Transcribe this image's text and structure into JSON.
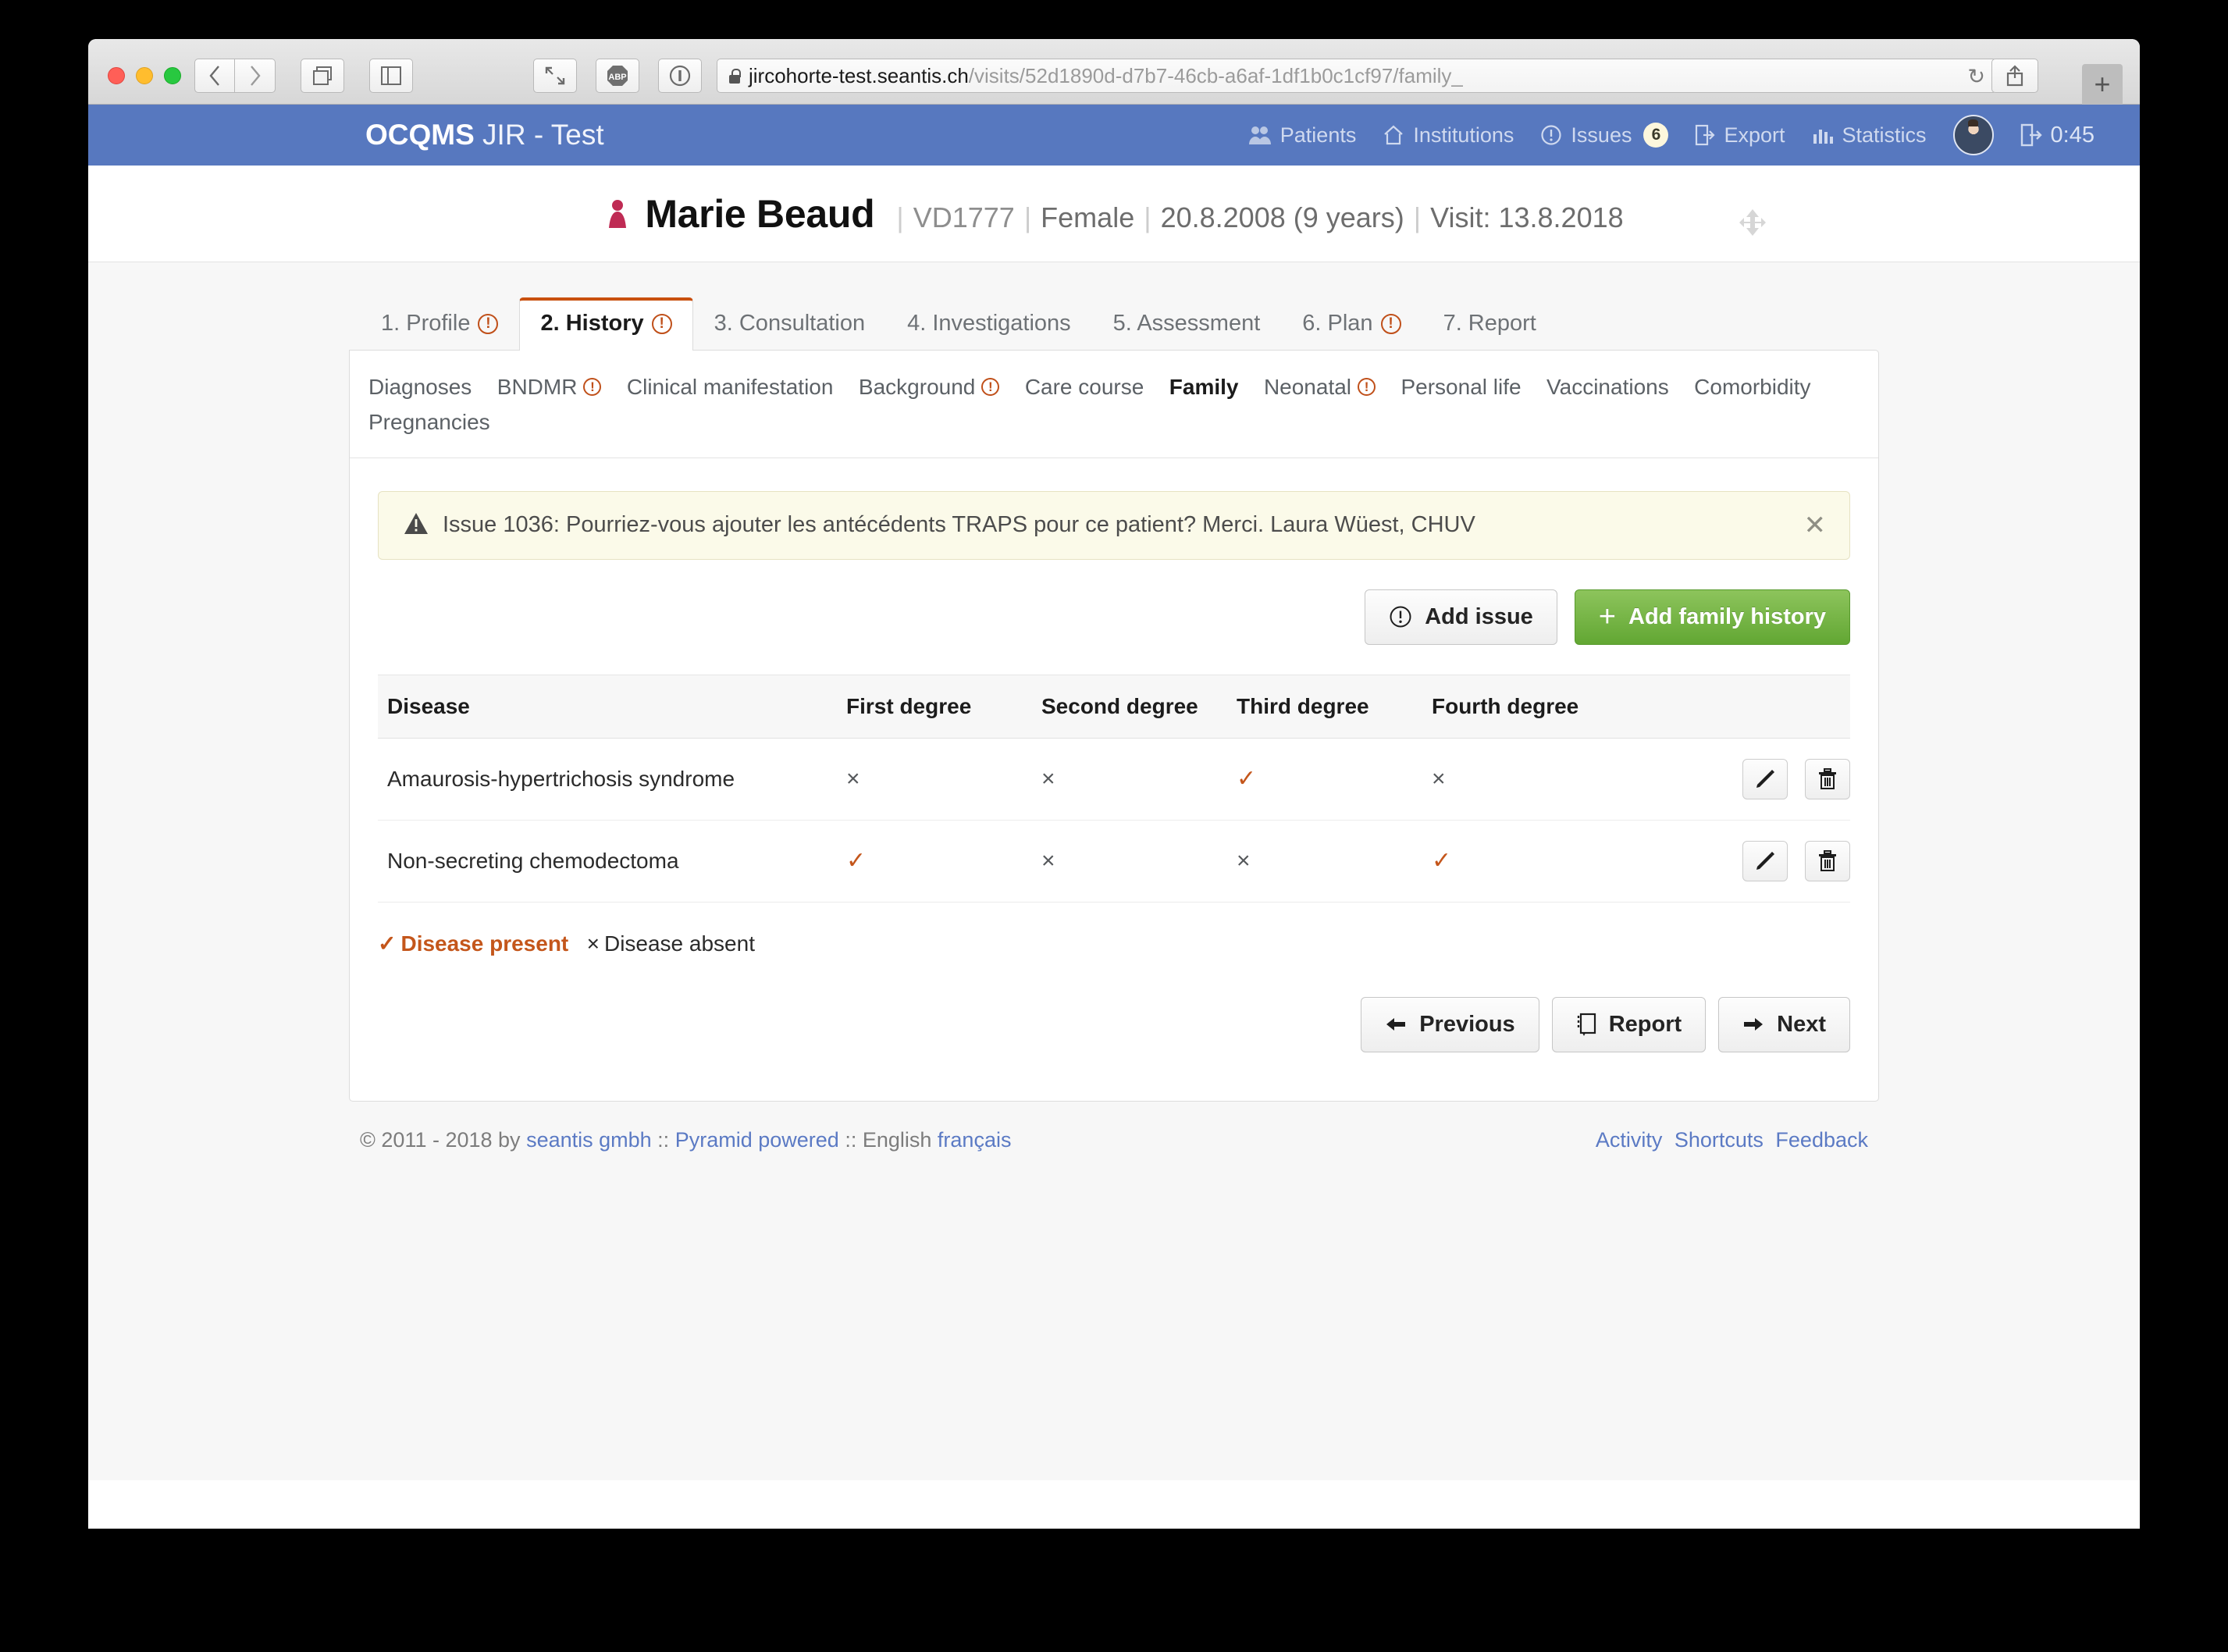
{
  "browser": {
    "url_host": "jircohorte-test.seantis.ch",
    "url_path": "/visits/52d1890d-d7b7-46cb-a6af-1df1b0c1cf97/family_",
    "back_label": "‹",
    "forward_label": "›",
    "abp_label": "ABP",
    "reload_label": "↻",
    "newtab_label": "+"
  },
  "navbar": {
    "brand_bold": "OCQMS",
    "brand_rest": " JIR - Test",
    "items": [
      {
        "label": "Patients",
        "icon": "people-icon"
      },
      {
        "label": "Institutions",
        "icon": "home-icon"
      },
      {
        "label": "Issues",
        "icon": "exclamation-circle-icon",
        "badge": "6"
      },
      {
        "label": "Export",
        "icon": "export-icon"
      },
      {
        "label": "Statistics",
        "icon": "bar-chart-icon"
      }
    ],
    "timer": "0:45"
  },
  "patient": {
    "name": "Marie Beaud",
    "id": "VD1777",
    "sex": "Female",
    "birth": "20.8.2008 (9 years)",
    "visit": "Visit: 13.8.2018",
    "sep": "|"
  },
  "tabs": [
    {
      "label": "1. Profile",
      "warn": true,
      "active": false
    },
    {
      "label": "2. History",
      "warn": true,
      "active": true
    },
    {
      "label": "3. Consultation",
      "warn": false,
      "active": false
    },
    {
      "label": "4. Investigations",
      "warn": false,
      "active": false
    },
    {
      "label": "5. Assessment",
      "warn": false,
      "active": false
    },
    {
      "label": "6. Plan",
      "warn": true,
      "active": false
    },
    {
      "label": "7. Report",
      "warn": false,
      "active": false
    }
  ],
  "subtabs": [
    {
      "label": "Diagnoses",
      "warn": false,
      "active": false
    },
    {
      "label": "BNDMR",
      "warn": true,
      "active": false
    },
    {
      "label": "Clinical manifestation",
      "warn": false,
      "active": false
    },
    {
      "label": "Background",
      "warn": true,
      "active": false
    },
    {
      "label": "Care course",
      "warn": false,
      "active": false
    },
    {
      "label": "Family",
      "warn": false,
      "active": true
    },
    {
      "label": "Neonatal",
      "warn": true,
      "active": false
    },
    {
      "label": "Personal life",
      "warn": false,
      "active": false
    },
    {
      "label": "Vaccinations",
      "warn": false,
      "active": false
    },
    {
      "label": "Comorbidity",
      "warn": false,
      "active": false
    },
    {
      "label": "Pregnancies",
      "warn": false,
      "active": false
    }
  ],
  "alert": {
    "text": "Issue 1036: Pourriez-vous ajouter les antécédents TRAPS pour ce patient? Merci. Laura Wüest, CHUV",
    "close_label": "✕"
  },
  "actions": {
    "add_issue": "Add issue",
    "add_family_history": "Add family history",
    "plus": "+"
  },
  "table": {
    "headers": [
      "Disease",
      "First degree",
      "Second degree",
      "Third degree",
      "Fourth degree"
    ],
    "rows": [
      {
        "disease": "Amaurosis-hypertrichosis syndrome",
        "first": "×",
        "second": "×",
        "third": "✓",
        "fourth": "×",
        "first_present": false,
        "second_present": false,
        "third_present": true,
        "fourth_present": false
      },
      {
        "disease": "Non-secreting chemodectoma",
        "first": "✓",
        "second": "×",
        "third": "×",
        "fourth": "✓",
        "first_present": true,
        "second_present": false,
        "third_present": false,
        "fourth_present": true
      }
    ]
  },
  "legend": {
    "present_mark": "✓",
    "present_label": "Disease present",
    "absent_mark": "×",
    "absent_label": "Disease absent"
  },
  "pager": {
    "previous": "Previous",
    "report": "Report",
    "next": "Next",
    "arrow_left": "⬅",
    "arrow_right": "➡"
  },
  "footer": {
    "copyright": "© 2011 - 2018 by",
    "seantis": "seantis gmbh",
    "sep1": "::",
    "pyramid": "Pyramid powered",
    "sep2": "::",
    "lang_en": "English",
    "lang_fr": "français",
    "activity": "Activity",
    "shortcuts": "Shortcuts",
    "feedback": "Feedback"
  },
  "colors": {
    "navbar": "#5778bf",
    "accent_orange": "#c4561b",
    "success_green": "#62a733",
    "alert_bg": "#fbfae9",
    "link_blue": "#5b7ac4"
  }
}
